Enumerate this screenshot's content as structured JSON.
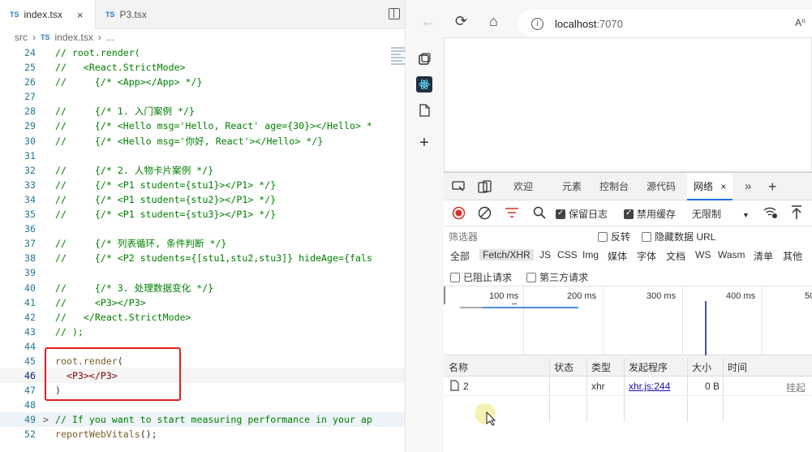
{
  "editor": {
    "tabs": [
      {
        "badge": "TS",
        "label": "index.tsx",
        "close": "×"
      },
      {
        "badge": "TS",
        "label": "P3.tsx"
      }
    ],
    "breadcrumb": {
      "folder": "src",
      "sep": "›",
      "badge": "TS",
      "file": "index.tsx",
      "more": "..."
    },
    "lines": [
      {
        "n": "24",
        "text": "// root.render("
      },
      {
        "n": "25",
        "text": "//   <React.StrictMode>"
      },
      {
        "n": "26",
        "text": "//     {/* <App></App> */}"
      },
      {
        "n": "27",
        "text": ""
      },
      {
        "n": "28",
        "text": "//     {/* 1. 入门案例 */}"
      },
      {
        "n": "29",
        "text": "//     {/* <Hello msg='Hello, React' age={30}></Hello> *"
      },
      {
        "n": "30",
        "text": "//     {/* <Hello msg='你好, React'></Hello> */}"
      },
      {
        "n": "31",
        "text": ""
      },
      {
        "n": "32",
        "text": "//     {/* 2. 人物卡片案例 */}"
      },
      {
        "n": "33",
        "text": "//     {/* <P1 student={stu1}></P1> */}"
      },
      {
        "n": "34",
        "text": "//     {/* <P1 student={stu2}></P1> */}"
      },
      {
        "n": "35",
        "text": "//     {/* <P1 student={stu3}></P1> */}"
      },
      {
        "n": "36",
        "text": ""
      },
      {
        "n": "37",
        "text": "//     {/* 列表循环, 条件判断 */}"
      },
      {
        "n": "38",
        "text": "//     {/* <P2 students={[stu1,stu2,stu3]} hideAge={fals"
      },
      {
        "n": "39",
        "text": ""
      },
      {
        "n": "40",
        "text": "//     {/* 3. 处理数据变化 */}"
      },
      {
        "n": "41",
        "text": "//     <P3></P3>"
      },
      {
        "n": "42",
        "text": "//   </React.StrictMode>"
      },
      {
        "n": "43",
        "text": "// );"
      },
      {
        "n": "44",
        "text": ""
      },
      {
        "n": "45",
        "fn": "root.render",
        "rest": "("
      },
      {
        "n": "46",
        "tag": "  <P3></P3>"
      },
      {
        "n": "47",
        "text": ")"
      },
      {
        "n": "48",
        "text": ""
      },
      {
        "n": "49",
        "fold": ">",
        "text": "// If you want to start measuring performance in your ap"
      },
      {
        "n": "52",
        "fn": "reportWebVitals",
        "rest": "();"
      }
    ]
  },
  "browser": {
    "back": "←",
    "reload": "⟳",
    "home": "⌂",
    "info": "i",
    "host": "localhost",
    "port": ":7070",
    "reader": "A⁰",
    "sidebar_add": "+",
    "devtools": {
      "tabs": [
        "欢迎",
        "元素",
        "控制台",
        "源代码",
        "网络"
      ],
      "active_close": "×",
      "more": "»",
      "add": "+",
      "toolbar": {
        "preserve_log": "保留日志",
        "disable_cache": "禁用缓存",
        "throttle": "无限制"
      },
      "filter_placeholder": "筛选器",
      "invert": "反转",
      "hide_data_urls": "隐藏数据 URL",
      "types": [
        "全部",
        "Fetch/XHR",
        "JS",
        "CSS",
        "Img",
        "媒体",
        "字体",
        "文档",
        "WS",
        "Wasm",
        "清单",
        "其他"
      ],
      "blocked_requests": "已阻止请求",
      "third_party": "第三方请求",
      "ticks": [
        "100 ms",
        "200 ms",
        "300 ms",
        "400 ms",
        "50"
      ],
      "columns": [
        "名称",
        "状态",
        "类型",
        "发起程序",
        "大小",
        "时间"
      ],
      "rows": [
        {
          "name": "2",
          "status": "",
          "type": "xhr",
          "initiator": "xhr.js:244",
          "size": "0 B",
          "time": "挂起"
        }
      ]
    }
  }
}
